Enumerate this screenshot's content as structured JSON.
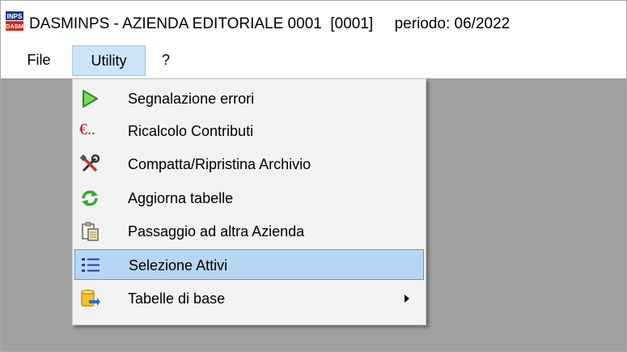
{
  "window": {
    "title": "DASMINPS - AZIENDA EDITORIALE 0001  [0001]     periodo: 06/2022",
    "icon_text_top": "INPS",
    "icon_text_bottom": "DASM"
  },
  "menubar": {
    "items": [
      {
        "label": "File",
        "icon": "none"
      },
      {
        "label": "Utility",
        "icon": "none"
      },
      {
        "label": "?",
        "icon": "none"
      }
    ],
    "active": "Utility"
  },
  "menu": {
    "items": [
      {
        "label": "Segnalazione errori",
        "icon": "play-arrow-icon"
      },
      {
        "label": "Ricalcolo Contributi",
        "icon": "euro-icon",
        "icon_text": "€.."
      },
      {
        "label": "Compatta/Ripristina Archivio",
        "icon": "tools-icon"
      },
      {
        "label": "Aggiorna tabelle",
        "icon": "refresh-icon"
      },
      {
        "label": "Passaggio ad altra Azienda",
        "icon": "paste-icon"
      },
      {
        "label": "Selezione Attivi",
        "icon": "list-icon",
        "highlighted": true
      },
      {
        "label": "Tabelle di base",
        "icon": "database-icon",
        "has_submenu": true
      }
    ]
  },
  "colors": {
    "client_bg": "#a0a0a0",
    "menu_bg": "#f2f2f2",
    "highlight_bg": "#b7d6f3",
    "highlight_border": "#5b9bd5",
    "menubar_active_bg": "#cce4f7"
  }
}
